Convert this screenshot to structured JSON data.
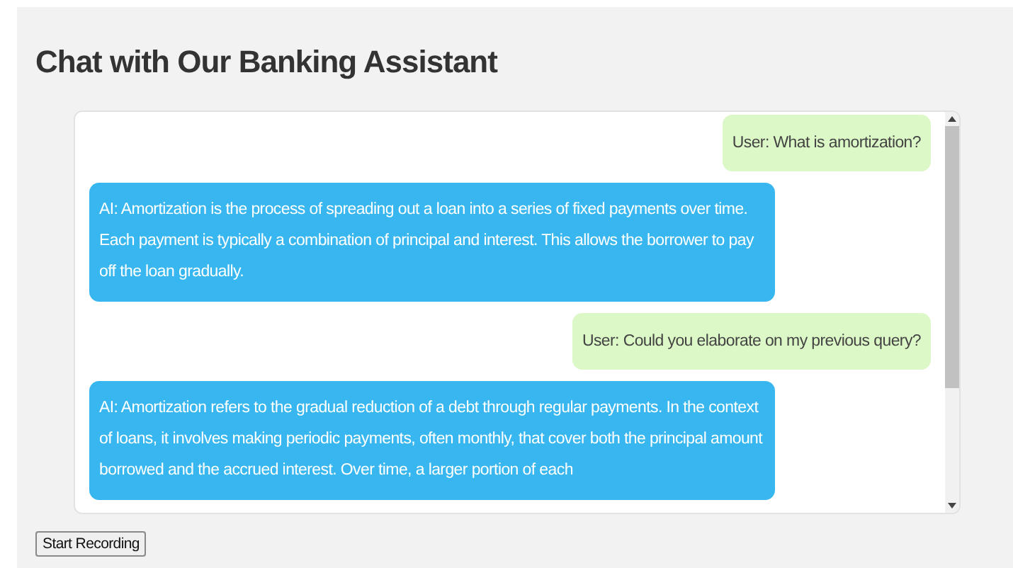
{
  "title": "Chat with Our Banking Assistant",
  "messages": [
    {
      "kind": "user",
      "text": "User: What is amortization?"
    },
    {
      "kind": "ai",
      "text": "AI: Amortization is the process of spreading out a loan into a series of fixed payments over time. Each payment is typically a combination of principal and interest. This allows the borrower to pay off the loan gradually."
    },
    {
      "kind": "user",
      "text": "User: Could you elaborate on my previous query?"
    },
    {
      "kind": "ai",
      "text": "AI: Amortization refers to the gradual reduction of a debt through regular payments. In the context of loans, it involves making periodic payments, often monthly, that cover both the principal amount borrowed and the accrued interest. Over time, a larger portion of each"
    }
  ],
  "button": "Start Recording"
}
